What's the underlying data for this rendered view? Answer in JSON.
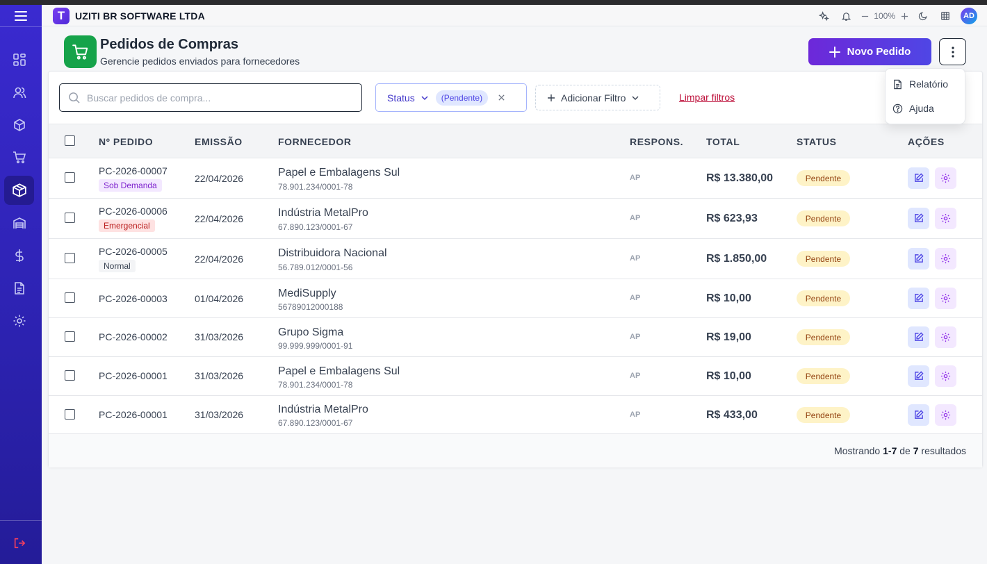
{
  "header": {
    "company": "UZITI BR SOFTWARE LTDA",
    "logo_letter": "T",
    "zoom": "100%",
    "user_initials": "AD"
  },
  "page": {
    "title": "Pedidos de Compras",
    "subtitle": "Gerencie pedidos enviados para fornecedores",
    "new_button": "Novo Pedido"
  },
  "menu": {
    "items": [
      "Relatório",
      "Ajuda"
    ]
  },
  "filters": {
    "search_placeholder": "Buscar pedidos de compra...",
    "status_label": "Status",
    "status_chip": "(Pendente)",
    "add_filter": "Adicionar Filtro",
    "clear": "Limpar filtros"
  },
  "table": {
    "columns": [
      "Nº PEDIDO",
      "EMISSÃO",
      "FORNECEDOR",
      "RESPONS.",
      "TOTAL",
      "STATUS",
      "AÇÕES"
    ],
    "rows": [
      {
        "order": "PC-2026-00007",
        "tag": "Sob Demanda",
        "date": "22/04/2026",
        "supplier": "Papel e Embalagens Sul",
        "cnpj": "78.901.234/0001-78",
        "resp": "AP",
        "total": "R$ 13.380,00",
        "status": "Pendente"
      },
      {
        "order": "PC-2026-00006",
        "tag": "Emergencial",
        "date": "22/04/2026",
        "supplier": "Indústria MetalPro",
        "cnpj": "67.890.123/0001-67",
        "resp": "AP",
        "total": "R$ 623,93",
        "status": "Pendente"
      },
      {
        "order": "PC-2026-00005",
        "tag": "Normal",
        "date": "22/04/2026",
        "supplier": "Distribuidora Nacional",
        "cnpj": "56.789.012/0001-56",
        "resp": "AP",
        "total": "R$ 1.850,00",
        "status": "Pendente"
      },
      {
        "order": "PC-2026-00003",
        "tag": "",
        "date": "01/04/2026",
        "supplier": "MediSupply",
        "cnpj": "56789012000188",
        "resp": "AP",
        "total": "R$ 10,00",
        "status": "Pendente"
      },
      {
        "order": "PC-2026-00002",
        "tag": "",
        "date": "31/03/2026",
        "supplier": "Grupo Sigma",
        "cnpj": "99.999.999/0001-91",
        "resp": "AP",
        "total": "R$ 19,00",
        "status": "Pendente"
      },
      {
        "order": "PC-2026-00001",
        "tag": "",
        "date": "31/03/2026",
        "supplier": "Papel e Embalagens Sul",
        "cnpj": "78.901.234/0001-78",
        "resp": "AP",
        "total": "R$ 10,00",
        "status": "Pendente"
      },
      {
        "order": "PC-2026-00001",
        "tag": "",
        "date": "31/03/2026",
        "supplier": "Indústria MetalPro",
        "cnpj": "67.890.123/0001-67",
        "resp": "AP",
        "total": "R$ 433,00",
        "status": "Pendente"
      }
    ]
  },
  "footer": {
    "prefix": "Mostrando",
    "range": "1-7",
    "of": "de",
    "count": "7",
    "suffix": "resultados"
  },
  "colors": {
    "sidebar": "#3a2ad0",
    "accent": "#6d28d9",
    "success_icon": "#16a34a",
    "pending_badge": "#fef3c7",
    "danger_link": "#be123c"
  }
}
